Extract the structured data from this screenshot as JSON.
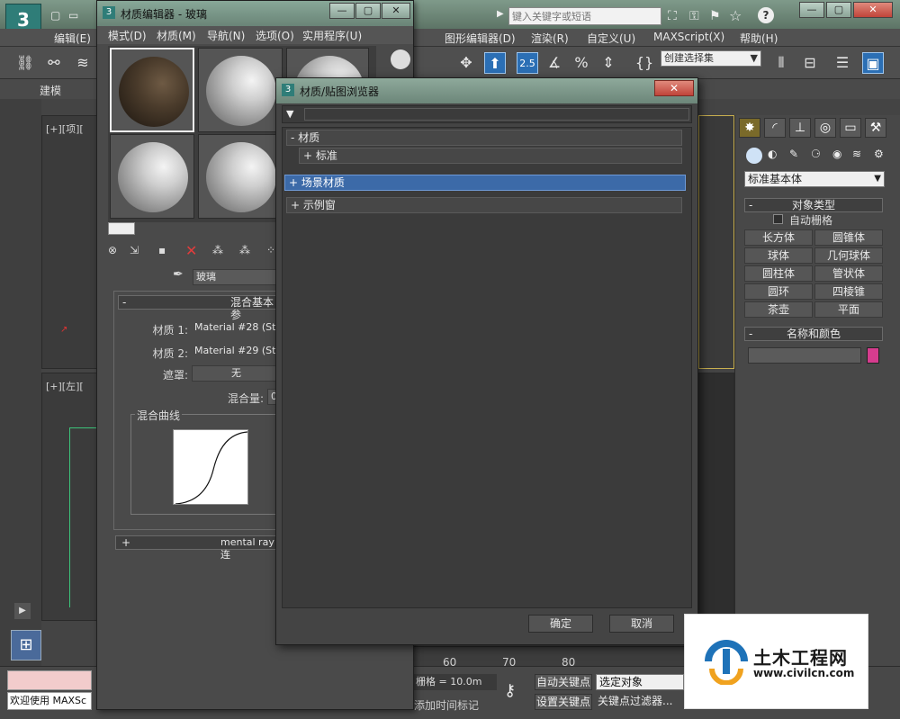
{
  "app": {
    "menu": [
      "编辑(E)",
      "图形编辑器(D)",
      "渲染(R)",
      "自定义(U)",
      "MAXScript(X)",
      "帮助(H)"
    ],
    "search_placeholder": "键入关键字或短语",
    "selection_set": "创建选择集",
    "tabs": [
      "建模"
    ],
    "viewport_top_label": "[+][项][",
    "viewport_left_label": "[+][左][",
    "timeline_ticks": [
      "60",
      "70",
      "80"
    ],
    "status": {
      "grid": "栅格 = 10.0m",
      "auto_key": "自动关键点",
      "selected_object": "选定对象",
      "set_key": "设置关键点",
      "key_filter": "关键点过滤器...",
      "add_time_tag": "添加时间标记",
      "welcome": "欢迎使用 MAXSc"
    }
  },
  "command_panel": {
    "dropdown": "标准基本体",
    "object_type_header": "对象类型",
    "autogrid_label": "自动栅格",
    "buttons": [
      "长方体",
      "圆锥体",
      "球体",
      "几何球体",
      "圆柱体",
      "管状体",
      "圆环",
      "四棱锥",
      "茶壶",
      "平面"
    ],
    "name_color_header": "名称和颜色",
    "object_color": "#d63c8e"
  },
  "material_editor": {
    "title": "材质编辑器 - 玻璃",
    "menu": [
      "模式(D)",
      "材质(M)",
      "导航(N)",
      "选项(O)",
      "实用程序(U)"
    ],
    "material_name": "玻璃",
    "blend_rollout_title": "混合基本参",
    "material1_label": "材质 1:",
    "material1_value": "Material #28 (Stan",
    "material2_label": "材质 2:",
    "material2_value": "Material #29 (Stan",
    "mask_label": "遮罩:",
    "mask_value": "无",
    "mix_amount_label": "混合量:",
    "mix_amount_value": "0.",
    "mix_curve_label": "混合曲线",
    "mentalray_rollout": "mental ray 连",
    "rollout_minus": "-",
    "rollout_plus": "+"
  },
  "browser": {
    "title": "材质/贴图浏览器",
    "categories": [
      {
        "label": "- 材质"
      },
      {
        "label": "+ 标准"
      },
      {
        "label": "+ 场景材质"
      },
      {
        "label": "+ 示例窗"
      }
    ],
    "ok": "确定",
    "cancel": "取消"
  },
  "watermark": {
    "title": "土木工程网",
    "url": "www.civilcn.com"
  },
  "accent_colors": {
    "selection_blue": "#3c6aa8",
    "title_green": "#7a9686"
  }
}
